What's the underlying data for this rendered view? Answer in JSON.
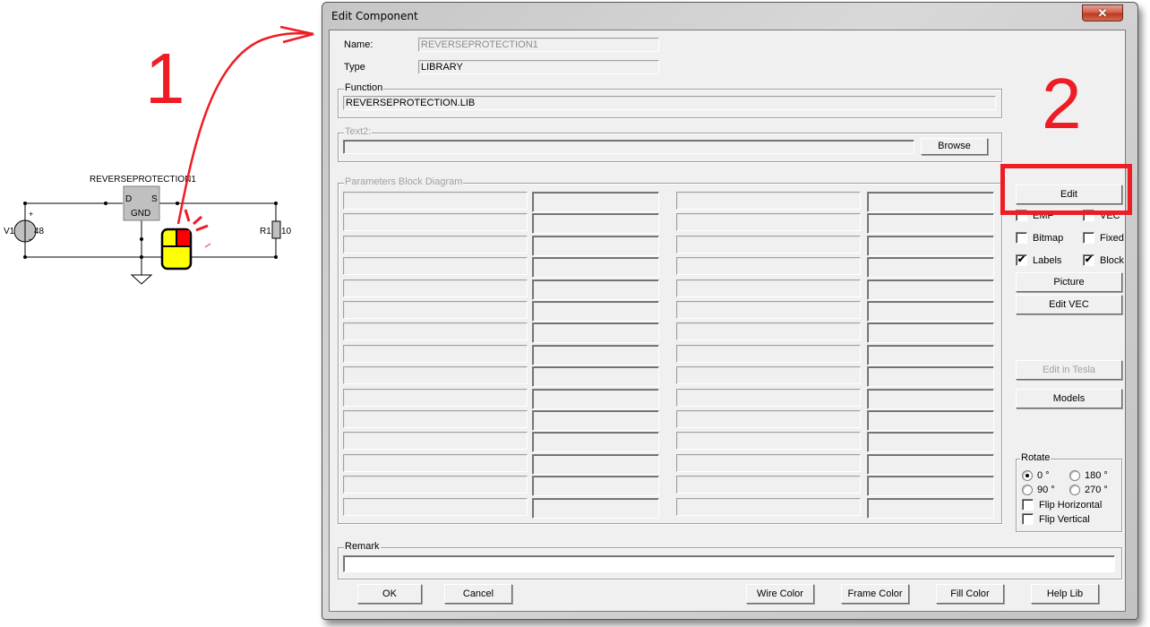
{
  "annotations": {
    "step1": "1",
    "step2": "2",
    "accent_color": "#ee1c25"
  },
  "schematic": {
    "component_label": "REVERSEPROTECTION1",
    "component_pins": {
      "left": "D",
      "right": "S",
      "bottom": "GND"
    },
    "source": {
      "name": "V1",
      "value": "48",
      "plus": "+",
      "minus": "-"
    },
    "resistor": {
      "name": "R1",
      "value": "10"
    },
    "mouse_icon": "mouse-right-click-icon"
  },
  "dialog": {
    "title": "Edit Component",
    "close_icon": "close-icon",
    "name_label": "Name:",
    "name_value": "REVERSEPROTECTION1",
    "type_label": "Type",
    "type_value": "LIBRARY",
    "function_label": "Function",
    "function_value": "REVERSEPROTECTION.LIB",
    "text2_label": "Text2:",
    "text2_value": "",
    "browse_label": "Browse",
    "params_label": "Parameters Block Diagram",
    "params_rows": 15,
    "params": [
      [
        "",
        "",
        "",
        ""
      ],
      [
        "",
        "",
        "",
        ""
      ],
      [
        "",
        "",
        "",
        ""
      ],
      [
        "",
        "",
        "",
        ""
      ],
      [
        "",
        "",
        "",
        ""
      ],
      [
        "",
        "",
        "",
        ""
      ],
      [
        "",
        "",
        "",
        ""
      ],
      [
        "",
        "",
        "",
        ""
      ],
      [
        "",
        "",
        "",
        ""
      ],
      [
        "",
        "",
        "",
        ""
      ],
      [
        "",
        "",
        "",
        ""
      ],
      [
        "",
        "",
        "",
        ""
      ],
      [
        "",
        "",
        "",
        ""
      ],
      [
        "",
        "",
        "",
        ""
      ],
      [
        "",
        "",
        "",
        ""
      ]
    ],
    "side": {
      "edit": "Edit",
      "emf": {
        "label": "EMF",
        "checked": false
      },
      "vec": {
        "label": "VEC",
        "checked": false
      },
      "bitmap": {
        "label": "Bitmap",
        "checked": false
      },
      "fixed": {
        "label": "Fixed",
        "checked": false
      },
      "labels": {
        "label": "Labels",
        "checked": true
      },
      "block": {
        "label": "Block",
        "checked": true
      },
      "picture": "Picture",
      "edit_vec": "Edit VEC",
      "edit_in_tesla": "Edit in Tesla",
      "models": "Models"
    },
    "rotate": {
      "label": "Rotate",
      "options": [
        "0 °",
        "180 °",
        "90 °",
        "270 °"
      ],
      "selected": "0 °",
      "flip_h": {
        "label": "Flip Horizontal",
        "checked": false
      },
      "flip_v": {
        "label": "Flip Vertical",
        "checked": false
      }
    },
    "remark_label": "Remark",
    "remark_value": "",
    "buttons": {
      "ok": "OK",
      "cancel": "Cancel",
      "wire_color": "Wire Color",
      "frame_color": "Frame Color",
      "fill_color": "Fill Color",
      "help_lib": "Help Lib"
    }
  }
}
